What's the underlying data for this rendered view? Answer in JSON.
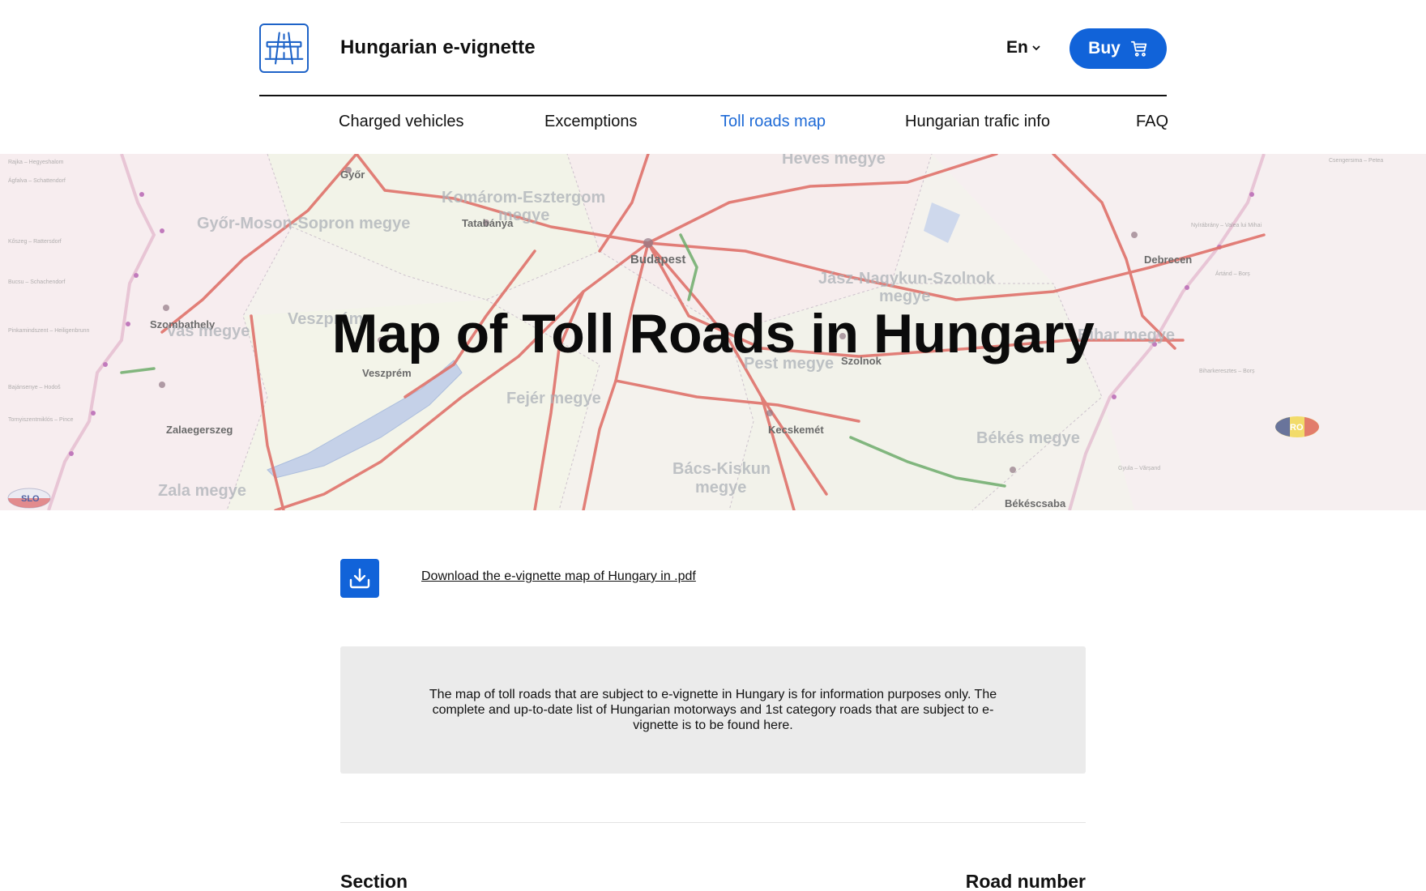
{
  "header": {
    "site_title": "Hungarian e-vignette",
    "language": "En",
    "buy_label": "Buy"
  },
  "nav": {
    "items": [
      {
        "label": "Charged vehicles",
        "active": false
      },
      {
        "label": "Excemptions",
        "active": false
      },
      {
        "label": "Toll roads map",
        "active": true
      },
      {
        "label": "Hungarian trafic info",
        "active": false
      },
      {
        "label": "FAQ",
        "active": false
      }
    ]
  },
  "hero": {
    "title": "Map of Toll Roads in Hungary",
    "map_labels": {
      "cities": [
        "Győr",
        "Tatabánya",
        "Budapest",
        "Debrecen",
        "Szombathely",
        "Veszprém",
        "Szolnok",
        "Zalaegerszeg",
        "Kecskemét",
        "Békéscsaba"
      ],
      "counties": [
        "Komárom-Esztergom megye",
        "Győr-Moson-Sopron megye",
        "Jász-Nagykun-Szolnok megye",
        "Vas megye",
        "Pest megye",
        "Fejér megye",
        "Békés megye",
        "Bács-Kiskun megye",
        "Zala megye",
        "Heves megye",
        "Hajdú-Bihar megye",
        "Veszprém"
      ],
      "country_badges": [
        "SLO",
        "RO"
      ]
    }
  },
  "download": {
    "link_text": "Download the e-vignette map of Hungary in .pdf"
  },
  "info": {
    "text": "The map of toll roads that are subject to e-vignette in Hungary is for information purposes only. The complete and up-to-date list of Hungarian motorways and 1st category roads that are subject to e-vignette is to be found here."
  },
  "table": {
    "col_section": "Section",
    "col_road": "Road number"
  },
  "colors": {
    "accent": "#1163d9",
    "nav_active": "#1e6ad6",
    "road_red": "#d9534a",
    "road_green": "#4e9a4a",
    "info_bg": "#ebebeb"
  }
}
